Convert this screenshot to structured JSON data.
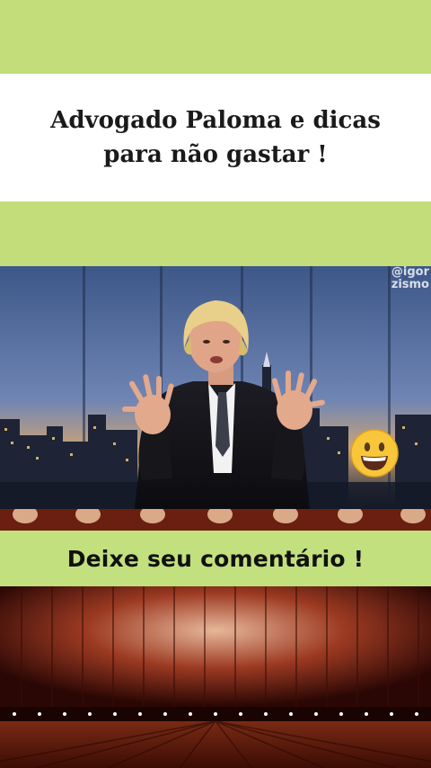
{
  "header": {
    "title": "Advogado Paloma e dicas para não gastar !"
  },
  "video": {
    "watermark_line1": "@igor",
    "watermark_line2": "zismo",
    "emoji_icon": "grinning-face-icon"
  },
  "footer": {
    "comment_text": "Deixe seu comentário !"
  },
  "colors": {
    "accent_green": "#c2dd7a",
    "stage_red": "#7a1e0e"
  }
}
